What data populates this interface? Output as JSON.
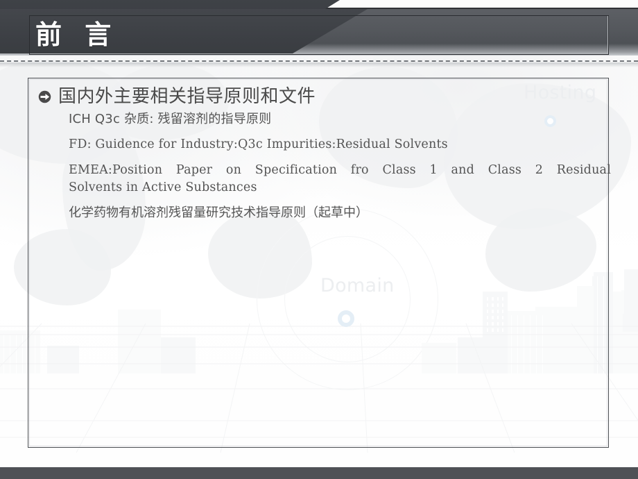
{
  "slide": {
    "title": "前 言",
    "heading": "国内外主要相关指导原则和文件",
    "lines": [
      "ICH Q3c 杂质: 残留溶剂的指导原则",
      "FD: Guidence for Industry:Q3c Impurities:Residual Solvents",
      "EMEA:Position Paper on Specification fro Class 1 and Class 2 Residual",
      "Solvents in Active Substances",
      "化学药物有机溶剂残留量研究技术指导原则（起草中）"
    ],
    "watermarks": {
      "hosting": "Hosting",
      "domain": "Domain"
    },
    "colors": {
      "header_dark": "#3a3d42",
      "header_gray": "#55585d",
      "footer_bar": "#4f5156",
      "title_text": "#ffffff",
      "heading_text": "#4a4a4a",
      "body_text": "#545454",
      "box_border": "#4a4d52",
      "watermark_text": "#eceef0",
      "watermark_dot": "#e4eef6"
    },
    "icons": {
      "bullet": "arrow-circle-right-icon"
    }
  }
}
